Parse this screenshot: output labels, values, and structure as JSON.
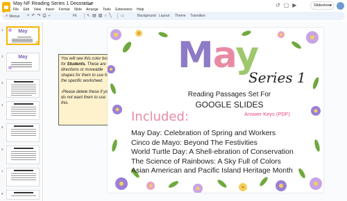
{
  "window": {
    "doc_title": "May NF Reading Series 1 Decorative",
    "menu": [
      "File",
      "Edit",
      "View",
      "Insert",
      "Format",
      "Slide",
      "Arrange",
      "Tools",
      "Extensions",
      "Help"
    ],
    "slideshow_label": "Slideshow"
  },
  "toolbar": {
    "menus_label": "Menus",
    "zoom_value": "Fit",
    "buttons": [
      "Background",
      "Layout",
      "Theme",
      "Transition"
    ]
  },
  "filmstrip": {
    "slide_numbers": [
      "1",
      "2",
      "3",
      "4",
      "5",
      "6",
      "7",
      "8"
    ]
  },
  "infobox": {
    "para1_pre": "You will see this color box for ",
    "para1_bold": "Students.",
    "para1_post": " These are directions or moveable shapes for them to use for the specific worksheet.",
    "para2": "-Please delete these if you do not want them to use this."
  },
  "slide": {
    "title_letters": [
      "M",
      "a",
      "y"
    ],
    "series": "Series 1",
    "subtitle1": "Reading Passages Set For",
    "subtitle2": "GOOGLE SLIDES",
    "answer_keys": "Answer Keys (PDF)",
    "included_label": "Included:",
    "passages": [
      "May Day: Celebration of Spring and Workers",
      "Cinco de Mayo: Beyond The Festivities",
      "World Turtle Day: A Shell-ebration of Conservation",
      "The Science of Rainbows: A Sky Full of Colors",
      "Asian American and Pacific Island Heritage Month"
    ]
  },
  "colors": {
    "title_m": "#8e7bc7",
    "title_a": "#e98aa5",
    "title_y": "#9fc76d",
    "included": "#e98aa5",
    "answer_keys": "#e8447b",
    "infobox_bg": "#fef2cc",
    "selected_thumb_border": "#f4b400"
  }
}
